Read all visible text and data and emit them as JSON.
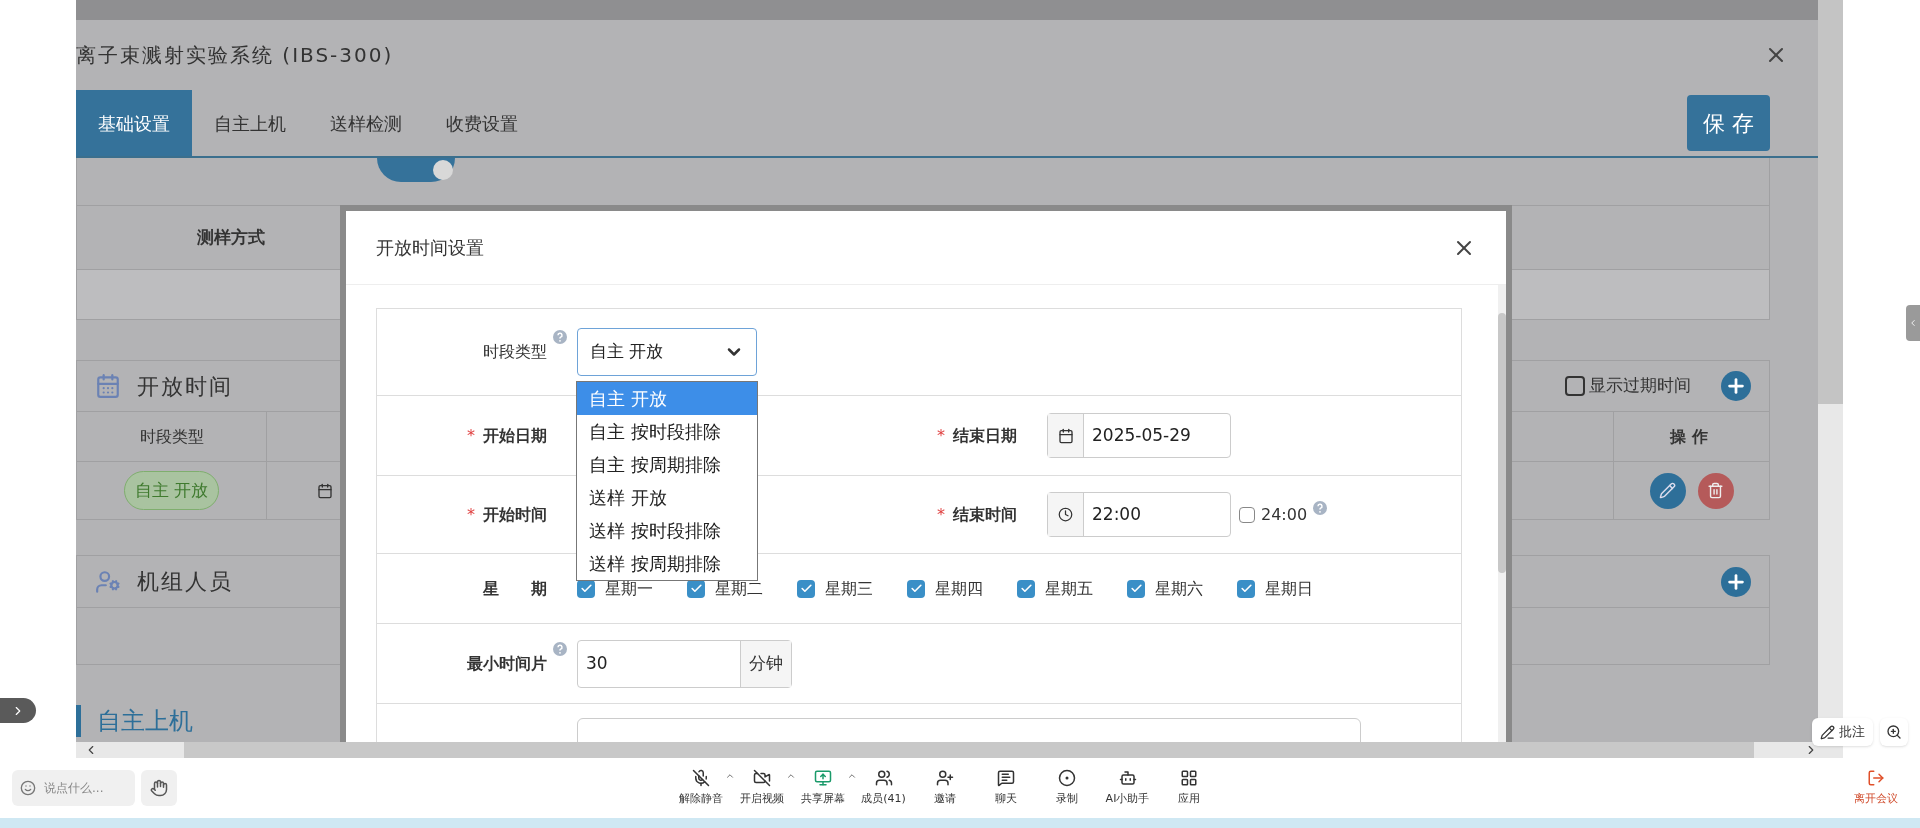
{
  "header": {
    "title": "离子束溅射实验系统 (IBS-300)"
  },
  "tabs": [
    {
      "label": "基础设置",
      "selected": true
    },
    {
      "label": "自主上机",
      "selected": false
    },
    {
      "label": "送样检测",
      "selected": false
    },
    {
      "label": "收费设置",
      "selected": false
    }
  ],
  "save_button": "保 存",
  "charging_toggle": {
    "on": true
  },
  "sampling_row": {
    "label": "测样方式"
  },
  "open_time": {
    "title": "开放时间",
    "show_expired": {
      "label": "显示过期时间",
      "checked": false
    },
    "columns": [
      "时段类型",
      "操作"
    ],
    "rows": [
      {
        "period_type": "自主 开放"
      }
    ]
  },
  "crew": {
    "title": "机组人员"
  },
  "next_section": {
    "title": "自主上机"
  },
  "modal": {
    "title": "开放时间设置",
    "period_type": {
      "label": "时段类型",
      "value": "自主 开放",
      "options": [
        {
          "label": "自主 开放",
          "selected": true
        },
        {
          "label": "自主 按时段排除",
          "selected": false
        },
        {
          "label": "自主 按周期排除",
          "selected": false
        },
        {
          "label": "送样 开放",
          "selected": false
        },
        {
          "label": "送样 按时段排除",
          "selected": false
        },
        {
          "label": "送样 按周期排除",
          "selected": false
        }
      ]
    },
    "start_date": {
      "label": "开始日期",
      "required_mark": "*"
    },
    "end_date": {
      "label": "结束日期",
      "required_mark": "*",
      "value": "2025-05-29"
    },
    "start_time": {
      "label": "开始时间",
      "required_mark": "*"
    },
    "end_time": {
      "label": "结束时间",
      "required_mark": "*",
      "value": "22:00",
      "all_day": {
        "label": "24:00",
        "checked": false
      }
    },
    "weekdays": {
      "label": "星　　期",
      "days": [
        {
          "label": "星期一",
          "checked": true
        },
        {
          "label": "星期二",
          "checked": true
        },
        {
          "label": "星期三",
          "checked": true
        },
        {
          "label": "星期四",
          "checked": true
        },
        {
          "label": "星期五",
          "checked": true
        },
        {
          "label": "星期六",
          "checked": true
        },
        {
          "label": "星期日",
          "checked": true
        }
      ]
    },
    "min_slice": {
      "label": "最小时间片",
      "value": "30",
      "unit": "分钟"
    }
  },
  "meeting_bar": {
    "chat_placeholder": "说点什么...",
    "tools": [
      {
        "kind": "mic",
        "label": "解除静音",
        "menu": true
      },
      {
        "kind": "video",
        "label": "开启视频",
        "menu": true
      },
      {
        "kind": "share",
        "label": "共享屏幕",
        "menu": true
      },
      {
        "kind": "members",
        "label": "成员(41)",
        "menu": false
      },
      {
        "kind": "invite",
        "label": "邀请",
        "menu": false
      },
      {
        "kind": "chat",
        "label": "聊天",
        "menu": false
      },
      {
        "kind": "record",
        "label": "录制",
        "menu": false
      },
      {
        "kind": "ai",
        "label": "AI小助手",
        "menu": false
      },
      {
        "kind": "apps",
        "label": "应用",
        "menu": false
      }
    ],
    "leave": "离开会议"
  },
  "annotate_button": "批注"
}
